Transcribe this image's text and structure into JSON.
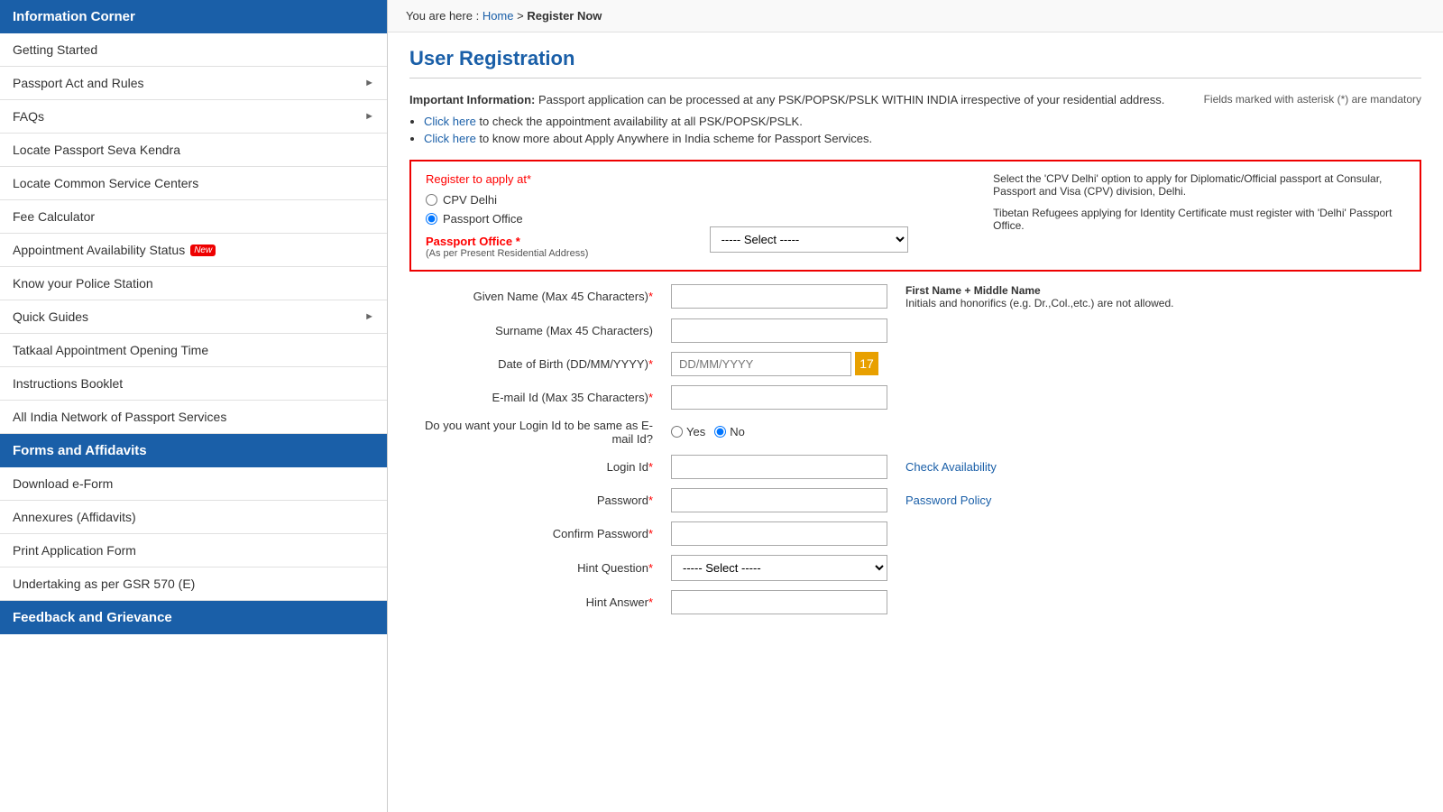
{
  "sidebar": {
    "section1_label": "Information Corner",
    "section2_label": "Forms and Affidavits",
    "section3_label": "Feedback and Grievance",
    "items": [
      {
        "label": "Getting Started",
        "arrow": false,
        "active": false,
        "new": false
      },
      {
        "label": "Passport Act and Rules",
        "arrow": true,
        "active": false,
        "new": false
      },
      {
        "label": "FAQs",
        "arrow": true,
        "active": false,
        "new": false
      },
      {
        "label": "Locate Passport Seva Kendra",
        "arrow": false,
        "active": false,
        "new": false
      },
      {
        "label": "Locate Common Service Centers",
        "arrow": false,
        "active": false,
        "new": false
      },
      {
        "label": "Fee Calculator",
        "arrow": false,
        "active": false,
        "new": false
      },
      {
        "label": "Appointment Availability Status",
        "arrow": false,
        "active": false,
        "new": true
      },
      {
        "label": "Know your Police Station",
        "arrow": false,
        "active": false,
        "new": false
      },
      {
        "label": "Quick Guides",
        "arrow": true,
        "active": false,
        "new": false
      },
      {
        "label": "Tatkaal Appointment Opening Time",
        "arrow": false,
        "active": false,
        "new": false
      },
      {
        "label": "Instructions Booklet",
        "arrow": false,
        "active": false,
        "new": false
      },
      {
        "label": "All India Network of Passport Services",
        "arrow": false,
        "active": false,
        "new": false
      }
    ],
    "forms_items": [
      {
        "label": "Download e-Form",
        "arrow": false,
        "active": false
      },
      {
        "label": "Annexures (Affidavits)",
        "arrow": false,
        "active": false
      },
      {
        "label": "Print Application Form",
        "arrow": false,
        "active": false
      },
      {
        "label": "Undertaking as per GSR 570 (E)",
        "arrow": false,
        "active": false
      }
    ]
  },
  "breadcrumb": {
    "prefix": "You are here : ",
    "home": "Home",
    "separator": " > ",
    "current": "Register Now"
  },
  "page": {
    "title": "User Registration",
    "important_label": "Important Information:",
    "important_text": " Passport application can be processed at any PSK/POPSK/PSLK WITHIN INDIA irrespective of your residential address.",
    "mandatory_note": "Fields marked with asterisk (*) are mandatory",
    "click_here1": "Click here",
    "link1_text": " to check the appointment availability at all PSK/POPSK/PSLK.",
    "click_here2": "Click here",
    "link2_text": " to know more about Apply Anywhere in India scheme for Passport Services."
  },
  "register_box": {
    "register_label": "Register to apply at",
    "req": "*",
    "option1": "CPV Delhi",
    "option2": "Passport Office",
    "hint_text": "Select the 'CPV Delhi' option to apply for Diplomatic/Official passport at Consular, Passport and Visa (CPV) division, Delhi.",
    "passport_office_label": "Passport Office",
    "passport_office_req": "*",
    "passport_office_sub": "(As per Present Residential Address)",
    "passport_select_default": "----- Select -----",
    "tibetan_note": "Tibetan Refugees applying for Identity Certificate must register with 'Delhi' Passport Office."
  },
  "form": {
    "given_name_label": "Given Name (Max 45 Characters)",
    "given_name_req": "*",
    "given_name_note": "First Name + Middle Name",
    "given_name_sub_note": "Initials and honorifics (e.g. Dr.,Col.,etc.) are not allowed.",
    "surname_label": "Surname (Max 45 Characters)",
    "dob_label": "Date of Birth (DD/MM/YYYY)",
    "dob_req": "*",
    "dob_placeholder": "DD/MM/YYYY",
    "email_label": "E-mail Id (Max 35 Characters)",
    "email_req": "*",
    "login_same_label": "Do you want your Login Id",
    "login_same_label2": " to be same as E-mail Id?",
    "login_same_yes": "Yes",
    "login_same_no": "No",
    "login_id_label": "Login Id",
    "login_id_req": "*",
    "check_availability": "Check Availability",
    "password_label": "Password",
    "password_req": "*",
    "password_policy": "Password Policy",
    "confirm_password_label": "Confirm Password",
    "confirm_password_req": "*",
    "hint_question_label": "Hint Question",
    "hint_question_req": "*",
    "hint_select_default": "----- Select -----",
    "hint_answer_label": "Hint Answer",
    "hint_answer_req": "*"
  }
}
